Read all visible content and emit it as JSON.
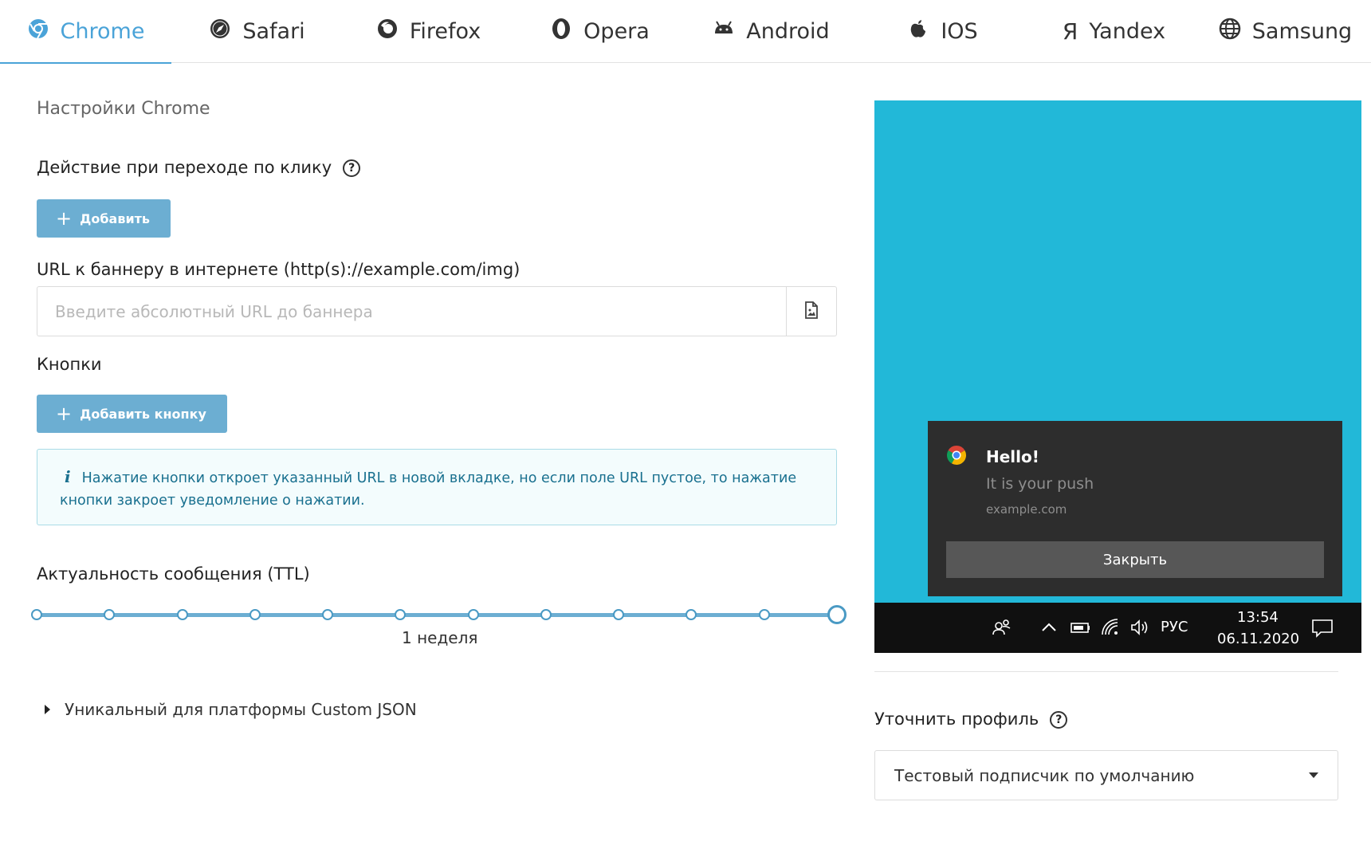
{
  "tabs": [
    {
      "label": "Chrome",
      "icon": "chrome-icon",
      "active": true
    },
    {
      "label": "Safari",
      "icon": "safari-icon"
    },
    {
      "label": "Firefox",
      "icon": "firefox-icon"
    },
    {
      "label": "Opera",
      "icon": "opera-icon"
    },
    {
      "label": "Android",
      "icon": "android-icon"
    },
    {
      "label": "IOS",
      "icon": "apple-icon"
    },
    {
      "label": "Yandex",
      "icon": "yandex-icon"
    },
    {
      "label": "Samsung",
      "icon": "globe-icon"
    }
  ],
  "settings": {
    "title": "Настройки Chrome",
    "click_action_label": "Действие при переходе по клику",
    "add_button": "Добавить",
    "banner_url_label": "URL к баннеру в интернете (http(s)://example.com/img)",
    "banner_url_placeholder": "Введите абсолютный URL до баннера",
    "banner_url_value": "",
    "buttons_label": "Кнопки",
    "add_button_button": "Добавить кнопку",
    "info_text": "Нажатие кнопки откроет указанный URL в новой вкладке, но если поле URL пустое, то нажатие кнопки закроет уведомление о нажатии.",
    "ttl_label": "Актуальность сообщения (TTL)",
    "ttl_value": "1 неделя",
    "ttl_steps": 12,
    "ttl_selected_index": 11,
    "custom_json_label": "Уникальный для платформы Custom JSON"
  },
  "preview": {
    "title": "Hello!",
    "body": "It is your push",
    "site": "example.com",
    "close_button": "Закрыть",
    "taskbar": {
      "lang": "РУС",
      "time": "13:54",
      "date": "06.11.2020"
    }
  },
  "profile": {
    "label": "Уточнить профиль",
    "selected": "Тестовый подписчик по умолчанию"
  },
  "colors": {
    "accent": "#4aa3d8",
    "button": "#6caed2",
    "preview_bg": "#22b8d8",
    "notification_bg": "#2d2d2d",
    "info_border": "#a9dbe6",
    "info_text": "#19708f"
  }
}
